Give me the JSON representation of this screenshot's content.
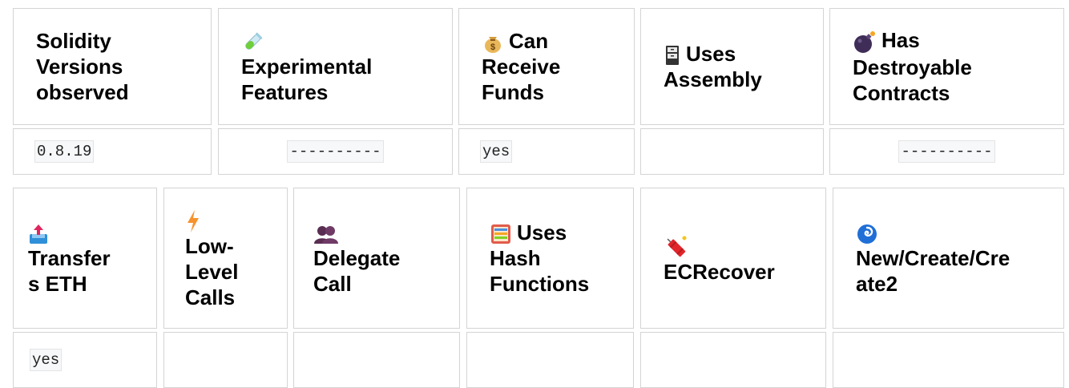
{
  "table1": {
    "headers": [
      {
        "icon": "",
        "lines": [
          "Solidity",
          "Versions",
          "observed"
        ]
      },
      {
        "icon": "test-tube-icon",
        "lines": [
          "Experimental",
          "Features"
        ]
      },
      {
        "icon": "money-bag-icon",
        "lines": [
          "Can",
          "Receive",
          "Funds"
        ]
      },
      {
        "icon": "file-cabinet-icon",
        "lines": [
          "Uses",
          "Assembly"
        ]
      },
      {
        "icon": "bomb-icon",
        "lines": [
          "Has",
          "Destroyable",
          "Contracts"
        ]
      }
    ],
    "values": [
      "0.8.19",
      "----------",
      "yes",
      "",
      "----------"
    ]
  },
  "table2": {
    "headers": [
      {
        "icon": "outbox-tray-icon",
        "lines": [
          "Transfer",
          "s ETH"
        ]
      },
      {
        "icon": "high-voltage-icon",
        "lines": [
          "Low-",
          "Level",
          "Calls"
        ]
      },
      {
        "icon": "busts-icon",
        "lines": [
          "Delegate",
          "Call"
        ]
      },
      {
        "icon": "abacus-icon",
        "lines": [
          "Uses",
          "Hash",
          "Functions"
        ]
      },
      {
        "icon": "firecracker-icon",
        "lines": [
          "ECRecover"
        ]
      },
      {
        "icon": "cyclone-icon",
        "lines": [
          "New/Create/Cre",
          "ate2"
        ]
      }
    ],
    "values": [
      "yes",
      "",
      "",
      "",
      "",
      ""
    ]
  }
}
